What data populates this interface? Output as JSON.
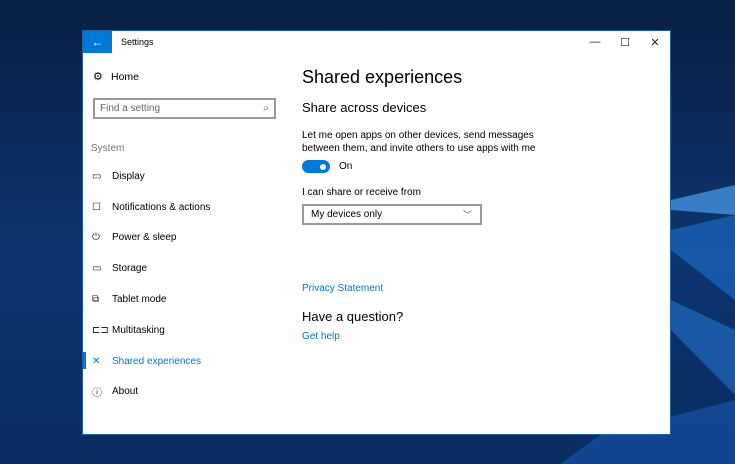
{
  "window": {
    "title": "Settings",
    "back_icon": "arrow-left",
    "controls": [
      "minimize",
      "maximize",
      "close"
    ]
  },
  "sidebar": {
    "home": "Home",
    "search_placeholder": "Find a setting",
    "section": "System",
    "items": [
      {
        "label": "Display",
        "icon": "monitor"
      },
      {
        "label": "Notifications & actions",
        "icon": "speech-bubble"
      },
      {
        "label": "Power & sleep",
        "icon": "power"
      },
      {
        "label": "Storage",
        "icon": "drive"
      },
      {
        "label": "Tablet mode",
        "icon": "tablet"
      },
      {
        "label": "Multitasking",
        "icon": "multitask"
      },
      {
        "label": "Shared experiences",
        "icon": "share",
        "active": true
      },
      {
        "label": "About",
        "icon": "info"
      }
    ]
  },
  "main": {
    "title": "Shared experiences",
    "section": "Share across devices",
    "description": "Let me open apps on other devices, send messages between them, and invite others to use apps with me",
    "toggle": {
      "state": "On",
      "value": true
    },
    "share_label": "I can share or receive from",
    "share_value": "My devices only",
    "privacy_link": "Privacy Statement",
    "question": "Have a question?",
    "help_link": "Get help"
  },
  "colors": {
    "accent": "#0078d7"
  }
}
